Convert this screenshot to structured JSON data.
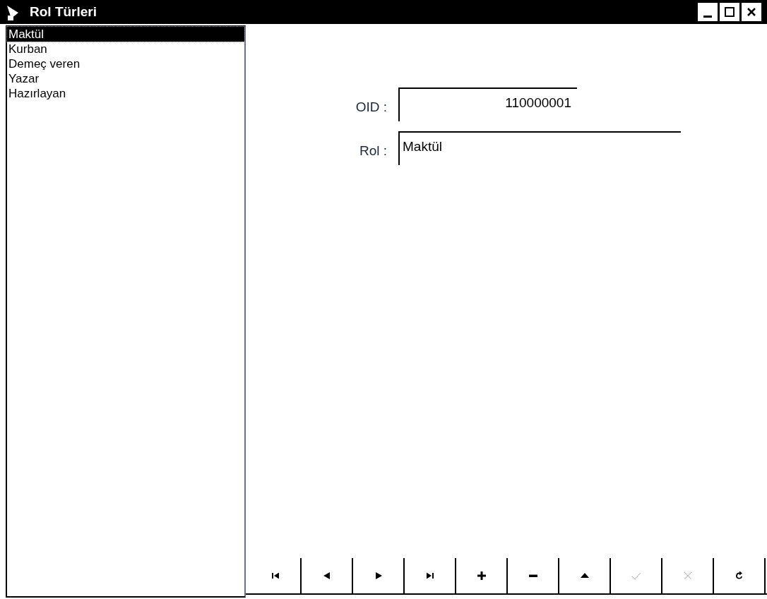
{
  "window": {
    "title": "Rol Türleri"
  },
  "list": {
    "items": [
      {
        "label": "Maktül",
        "selected": true
      },
      {
        "label": "Kurban",
        "selected": false
      },
      {
        "label": "Demeç veren",
        "selected": false
      },
      {
        "label": "Yazar",
        "selected": false
      },
      {
        "label": "Hazırlayan",
        "selected": false
      }
    ]
  },
  "form": {
    "fields": [
      {
        "label": "OID :",
        "value": "110000001",
        "kind": "number"
      },
      {
        "label": "Rol :",
        "value": "Maktül",
        "kind": "text"
      }
    ]
  },
  "navigator": {
    "buttons": [
      {
        "kind": "first",
        "disabled": false
      },
      {
        "kind": "prior",
        "disabled": false
      },
      {
        "kind": "next",
        "disabled": false
      },
      {
        "kind": "last",
        "disabled": false
      },
      {
        "kind": "insert",
        "disabled": false
      },
      {
        "kind": "delete",
        "disabled": false
      },
      {
        "kind": "edit",
        "disabled": false
      },
      {
        "kind": "post",
        "disabled": true
      },
      {
        "kind": "cancel",
        "disabled": true
      },
      {
        "kind": "refresh",
        "disabled": false
      }
    ]
  }
}
